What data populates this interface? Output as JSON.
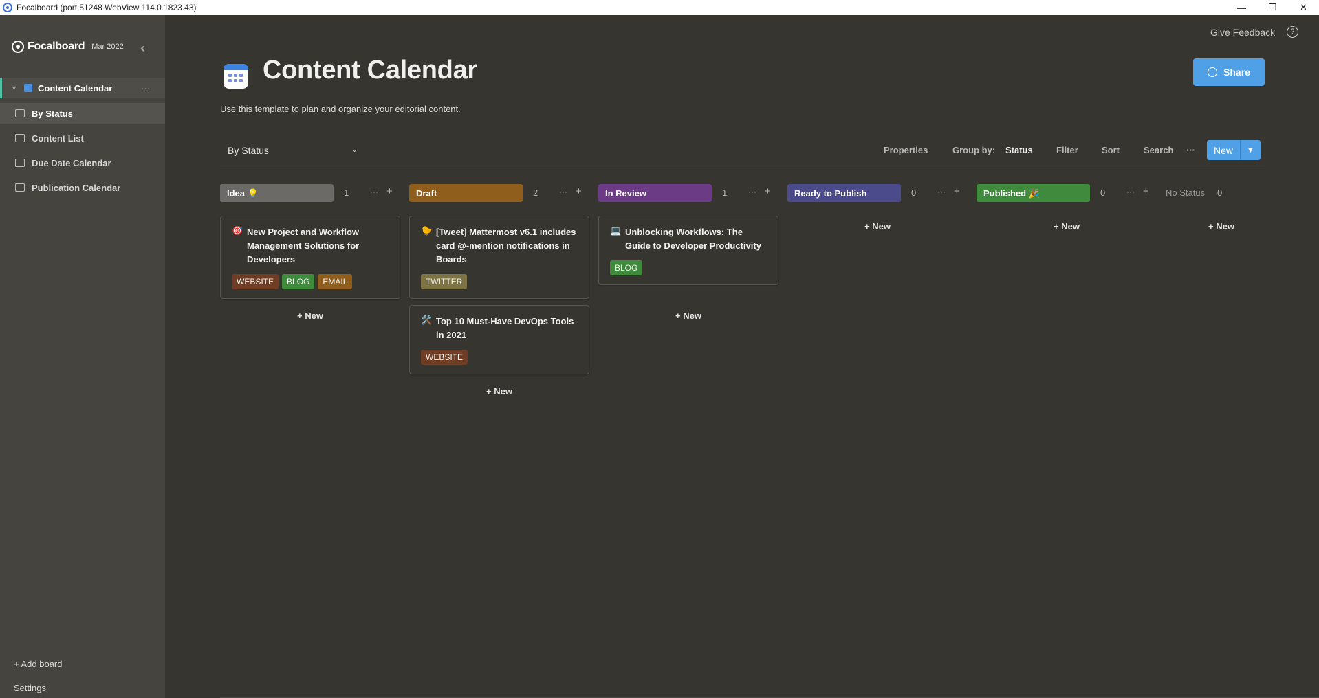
{
  "window": {
    "title": "Focalboard (port 51248 WebView 114.0.1823.43)",
    "controls": [
      "—",
      "❐",
      "✕"
    ]
  },
  "sidebar": {
    "brand": "Focalboard",
    "version": "Mar 2022",
    "collapse_icon": "double-chevron-left",
    "board": {
      "name": "Content Calendar",
      "menu": "···"
    },
    "views": [
      {
        "label": "By Status",
        "icon": "board-icon"
      },
      {
        "label": "Content List",
        "icon": "table-icon"
      },
      {
        "label": "Due Date Calendar",
        "icon": "calendar-icon"
      },
      {
        "label": "Publication Calendar",
        "icon": "calendar-icon"
      }
    ],
    "add_board": "+ Add board",
    "settings": "Settings"
  },
  "header": {
    "feedback": "Give Feedback",
    "help": "?",
    "title": "Content Calendar",
    "description": "Use this template to plan and organize your editorial content.",
    "share": "Share"
  },
  "toolbar": {
    "view": "By Status",
    "properties": "Properties",
    "group_by_label": "Group by:",
    "group_by_value": "Status",
    "filter": "Filter",
    "sort": "Sort",
    "search": "Search",
    "more": "···",
    "new": "New"
  },
  "columns": [
    {
      "label": "Idea 💡",
      "count": "1",
      "color": "#6b6a66"
    },
    {
      "label": "Draft",
      "count": "2",
      "color": "#8f5e1c"
    },
    {
      "label": "In Review",
      "count": "1",
      "color": "#6c3b86"
    },
    {
      "label": "Ready to Publish",
      "count": "0",
      "color": "#4b4a8a"
    },
    {
      "label": "Published 🎉",
      "count": "0",
      "color": "#3f8a3c"
    }
  ],
  "no_status": {
    "label": "No Status",
    "count": "0"
  },
  "column_menu": "···",
  "column_add": "+",
  "add_new": "+ New",
  "cards": [
    {
      "emoji": "🎯",
      "title": "New Project and Workflow Management Solutions for Developers",
      "tags": [
        "WEBSITE",
        "BLOG",
        "EMAIL"
      ]
    },
    {
      "emoji": "🐤",
      "title": "[Tweet] Mattermost v6.1 includes card @-mention notifications in Boards",
      "tags": [
        "TWITTER"
      ]
    },
    {
      "emoji": "🛠️",
      "title": "Top 10 Must-Have DevOps Tools in 2021",
      "tags": [
        "WEBSITE"
      ]
    },
    {
      "emoji": "💻",
      "title": "Unblocking Workflows: The Guide to Developer Productivity",
      "tags": [
        "BLOG"
      ]
    }
  ],
  "tag_colors": {
    "WEBSITE": "#6e3d24",
    "BLOG": "#3f8a3c",
    "EMAIL": "#8f5e1c",
    "TWITTER": "#7d7344"
  }
}
